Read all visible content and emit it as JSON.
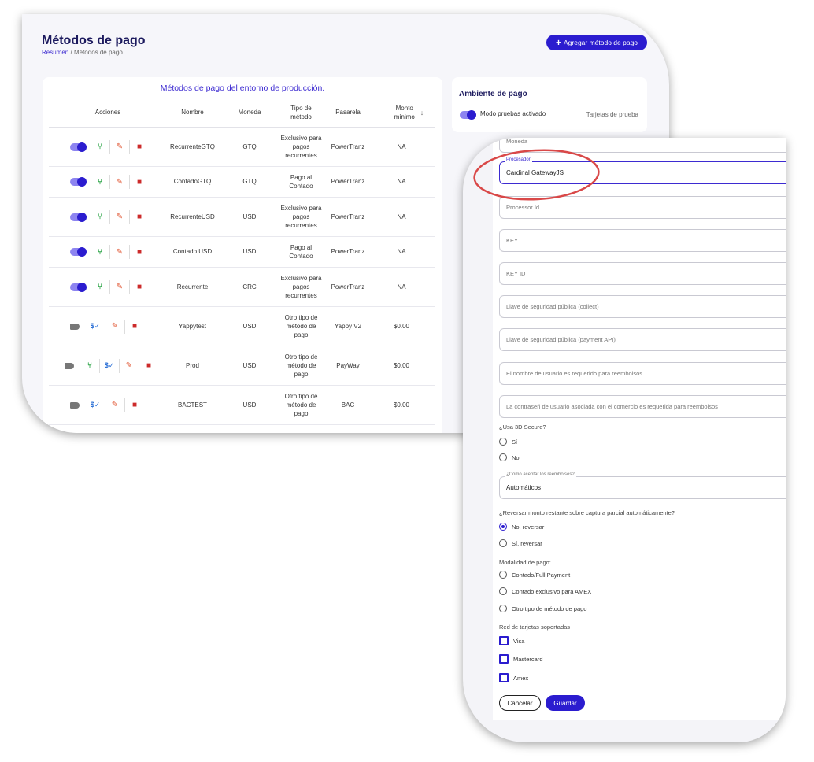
{
  "header": {
    "title": "Métodos de pago",
    "breadcrumb": {
      "link": "Resumen",
      "separator": "/",
      "current": "Métodos de pago"
    },
    "add_button": {
      "icon": "plus-icon",
      "label": "Agregar método de pago"
    }
  },
  "table": {
    "heading": "Métodos de pago del entorno de producción.",
    "columns": {
      "actions": "Acciones",
      "name": "Nombre",
      "currency": "Moneda",
      "method_type": "Tipo de método",
      "gateway": "Pasarela",
      "min_amount": "Monto mínimo"
    },
    "rows": [
      {
        "enabled": true,
        "icons": [
          "toggle-on-icon",
          "branch-icon",
          "edit-icon",
          "delete-icon"
        ],
        "name": "RecurrenteGTQ",
        "currency": "GTQ",
        "method_type": "Exclusivo para pagos recurrentes",
        "gateway": "PowerTranz",
        "min_amount": "NA"
      },
      {
        "enabled": true,
        "icons": [
          "toggle-on-icon",
          "branch-icon",
          "edit-icon",
          "delete-icon"
        ],
        "name": "ContadoGTQ",
        "currency": "GTQ",
        "method_type": "Pago al Contado",
        "gateway": "PowerTranz",
        "min_amount": "NA"
      },
      {
        "enabled": true,
        "icons": [
          "toggle-on-icon",
          "branch-icon",
          "edit-icon",
          "delete-icon"
        ],
        "name": "RecurrenteUSD",
        "currency": "USD",
        "method_type": "Exclusivo para pagos recurrentes",
        "gateway": "PowerTranz",
        "min_amount": "NA"
      },
      {
        "enabled": true,
        "icons": [
          "toggle-on-icon",
          "branch-icon",
          "edit-icon",
          "delete-icon"
        ],
        "name": "Contado USD",
        "currency": "USD",
        "method_type": "Pago al Contado",
        "gateway": "PowerTranz",
        "min_amount": "NA"
      },
      {
        "enabled": true,
        "icons": [
          "toggle-on-icon",
          "branch-icon",
          "edit-icon",
          "delete-icon"
        ],
        "name": "Recurrente",
        "currency": "CRC",
        "method_type": "Exclusivo para pagos recurrentes",
        "gateway": "PowerTranz",
        "min_amount": "NA"
      },
      {
        "enabled": false,
        "icons": [
          "toggle-off-icon",
          "dollar-check-icon",
          "edit-icon",
          "delete-icon"
        ],
        "name": "Yappytest",
        "currency": "USD",
        "method_type": "Otro tipo de método de pago",
        "gateway": "Yappy V2",
        "min_amount": "$0.00"
      },
      {
        "enabled": false,
        "icons": [
          "toggle-off-icon",
          "branch-icon",
          "dollar-check-icon",
          "edit-icon",
          "delete-icon"
        ],
        "name": "Prod",
        "currency": "USD",
        "method_type": "Otro tipo de método de pago",
        "gateway": "PayWay",
        "min_amount": "$0.00"
      },
      {
        "enabled": false,
        "icons": [
          "toggle-off-icon",
          "dollar-check-icon",
          "edit-icon",
          "delete-icon"
        ],
        "name": "BACTEST",
        "currency": "USD",
        "method_type": "Otro tipo de método de pago",
        "gateway": "BAC",
        "min_amount": "$0.00"
      }
    ]
  },
  "environment": {
    "title": "Ambiente de pago",
    "toggle_label": "Modo pruebas activado",
    "right_label": "Tarjetas de prueba"
  },
  "form": {
    "currency_field": {
      "placeholder": "Moneda"
    },
    "processor_field": {
      "label": "Procesador",
      "value": "Cardinal GatewayJS"
    },
    "text_fields": [
      "Processor Id",
      "KEY",
      "KEY ID",
      "Llave de seguridad pública (collect)",
      "Llave de seguridad pública (payment API)",
      "El nombre de usuario es requerido para reembolsos",
      "La contraseñ de usuario asociada con el comercio es requerida para reembolsos"
    ],
    "secure3d": {
      "question": "¿Usa 3D Secure?",
      "options": [
        "Sí",
        "No"
      ]
    },
    "refunds": {
      "label": "¿Como aceptar los reembolsos?",
      "value": "Automáticos"
    },
    "reverse": {
      "question": "¿Reversar monto restante sobre captura parcial automáticamente?",
      "options": [
        "No, reversar",
        "Sí, reversar"
      ],
      "selected": 0
    },
    "payment_mode": {
      "question": "Modalidad de pago:",
      "options": [
        "Contado/Full Payment",
        "Contado exclusivo para AMEX",
        "Otro tipo de método de pago"
      ]
    },
    "card_networks": {
      "question": "Red de tarjetas soportadas",
      "options": [
        "Visa",
        "Mastercard",
        "Amex"
      ]
    },
    "cancel_label": "Cancelar",
    "save_label": "Guardar"
  },
  "colors": {
    "accent": "#2b1ccf",
    "highlight_ring": "#d94848",
    "delete": "#cc2a2a",
    "edit": "#e0512d",
    "branch": "#30a64a"
  }
}
